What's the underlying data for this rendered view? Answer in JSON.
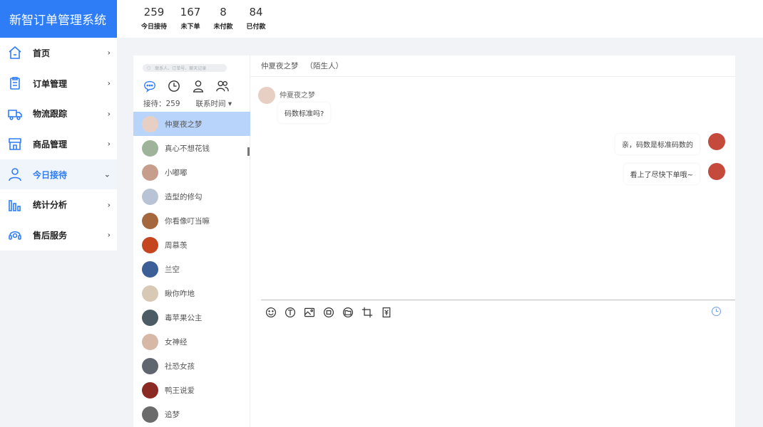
{
  "brand": {
    "title": "新智订单管理系统"
  },
  "stats": [
    {
      "value": "259",
      "label": "今日接待"
    },
    {
      "value": "167",
      "label": "未下单"
    },
    {
      "value": "8",
      "label": "未付款"
    },
    {
      "value": "84",
      "label": "已付款"
    }
  ],
  "nav": [
    {
      "label": "首页",
      "icon": "home-icon",
      "arrow": "›"
    },
    {
      "label": "订单管理",
      "icon": "clipboard-icon",
      "arrow": "›"
    },
    {
      "label": "物流跟踪",
      "icon": "truck-icon",
      "arrow": "›"
    },
    {
      "label": "商品管理",
      "icon": "store-icon",
      "arrow": "›"
    },
    {
      "label": "今日接待",
      "icon": "user-icon",
      "arrow": "⌄",
      "active": true
    },
    {
      "label": "统计分析",
      "icon": "bar-chart-icon",
      "arrow": "›"
    },
    {
      "label": "售后服务",
      "icon": "headset-icon",
      "arrow": "›"
    }
  ],
  "contacts": {
    "search_placeholder": "联系人、订单号、聊天记录",
    "received_label": "接待：259",
    "sort_label": "联系时间 ▾",
    "items": [
      {
        "name": "仲夏夜之梦",
        "color": "#e8cfc4",
        "active": true
      },
      {
        "name": "真心不想花钱",
        "color": "#9eb39a"
      },
      {
        "name": "小嘟嘟",
        "color": "#c79e8c"
      },
      {
        "name": "造型的修勾",
        "color": "#b9c3d6"
      },
      {
        "name": "你看像叮当嘛",
        "color": "#a5673e"
      },
      {
        "name": "周慕羡",
        "color": "#c5451f"
      },
      {
        "name": "兰空",
        "color": "#3b5f96"
      },
      {
        "name": "瞅你咋地",
        "color": "#d8c9b4"
      },
      {
        "name": "毒苹果公主",
        "color": "#4b5c64"
      },
      {
        "name": "女神经",
        "color": "#d7b8a6"
      },
      {
        "name": "社恐女孩",
        "color": "#5f6670"
      },
      {
        "name": "鸭王说爱",
        "color": "#8a2a22"
      },
      {
        "name": "追梦",
        "color": "#6b6b6b"
      }
    ]
  },
  "chat": {
    "header_name": "仲夏夜之梦",
    "header_tag": "（陌生人）",
    "sender_name": "仲夏夜之梦",
    "messages": [
      {
        "text": "码数标准吗?"
      },
      {
        "text": "亲，码数是标准码数的"
      },
      {
        "text": "看上了尽快下单哦~"
      }
    ]
  }
}
